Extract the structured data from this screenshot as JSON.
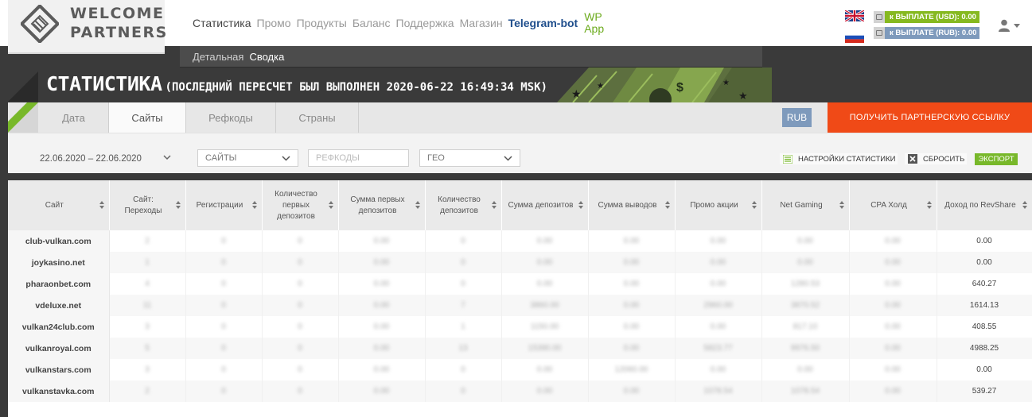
{
  "logo": {
    "line1": "WELCOME",
    "line2": "PARTNERS"
  },
  "topnav": {
    "items": [
      "Статистика",
      "Промо",
      "Продукты",
      "Баланс",
      "Поддержка",
      "Магазин"
    ],
    "telegram": "Telegram-bot",
    "wp_line1": "WP",
    "wp_line2": "App"
  },
  "payouts": {
    "usd": "к ВЫПЛАТЕ (USD): 0.00",
    "rub": "к ВЫПЛАТЕ (RUB): 0.00"
  },
  "subnav": {
    "items": [
      "Детальная",
      "Сводка"
    ]
  },
  "page": {
    "title": "СТАТИСТИКА",
    "subtitle": "(ПОСЛЕДНИЙ ПЕРЕСЧЕТ БЫЛ ВЫПОЛНЕН 2020-06-22 16:49:34 MSK)"
  },
  "tabs": [
    "Дата",
    "Сайты",
    "Рефкоды",
    "Страны"
  ],
  "currency_button": "RUB",
  "cta_button": "ПОЛУЧИТЬ ПАРТНЕРСКУЮ ССЫЛКУ",
  "filters": {
    "date_range": "22.06.2020  –  22.06.2020",
    "sites_select": "САЙТЫ",
    "refcodes_placeholder": "РЕФКОДЫ",
    "geo_select": "ГЕО",
    "settings_label": "НАСТРОЙКИ СТАТИСТИКИ",
    "reset_label": "СБРОСИТЬ",
    "export_label": "ЭКСПОРТ"
  },
  "table": {
    "headers": [
      "Сайт",
      "Сайт: Переходы",
      "Регистрации",
      "Количество первых депозитов",
      "Сумма первых депозитов",
      "Количество депозитов",
      "Сумма депозитов",
      "Сумма выводов",
      "Промо акции",
      "Net Gaming",
      "CPA Холд",
      "Доход по RevShare"
    ],
    "rows": [
      {
        "site": "club-vulkan.com",
        "cells": [
          "2",
          "0",
          "0",
          "0.00",
          "0",
          "0.00",
          "0.00",
          "0.00",
          "0.00",
          "0.00"
        ],
        "revshare": "0.00"
      },
      {
        "site": "joykasino.net",
        "cells": [
          "1",
          "0",
          "0",
          "0.00",
          "0",
          "0.00",
          "0.00",
          "0.00",
          "0.00",
          "0.00"
        ],
        "revshare": "0.00"
      },
      {
        "site": "pharaonbet.com",
        "cells": [
          "4",
          "0",
          "0",
          "0.00",
          "0",
          "0.00",
          "0.00",
          "0.00",
          "1280.53",
          "0.00"
        ],
        "revshare": "640.27"
      },
      {
        "site": "vdeluxe.net",
        "cells": [
          "11",
          "0",
          "0",
          "0.00",
          "7",
          "3860.00",
          "0.00",
          "2960.00",
          "3870.52",
          "0.00"
        ],
        "revshare": "1614.13"
      },
      {
        "site": "vulkan24club.com",
        "cells": [
          "3",
          "0",
          "0",
          "0.00",
          "1",
          "1150.00",
          "0.00",
          "0.00",
          "817.10",
          "0.00"
        ],
        "revshare": "408.55"
      },
      {
        "site": "vulkanroyal.com",
        "cells": [
          "5",
          "0",
          "0",
          "0.00",
          "13",
          "15390.00",
          "0.00",
          "5823.77",
          "9976.50",
          "0.00"
        ],
        "revshare": "4988.25"
      },
      {
        "site": "vulkanstars.com",
        "cells": [
          "3",
          "0",
          "0",
          "0.00",
          "0",
          "0.00",
          "12060.00",
          "0.00",
          "0.00",
          "0.00"
        ],
        "revshare": "0.00"
      },
      {
        "site": "vulkanstavka.com",
        "cells": [
          "2",
          "0",
          "0",
          "0.00",
          "0",
          "0.00",
          "0.00",
          "1078.54",
          "1078.54",
          "0.00"
        ],
        "revshare": "539.27"
      }
    ]
  }
}
